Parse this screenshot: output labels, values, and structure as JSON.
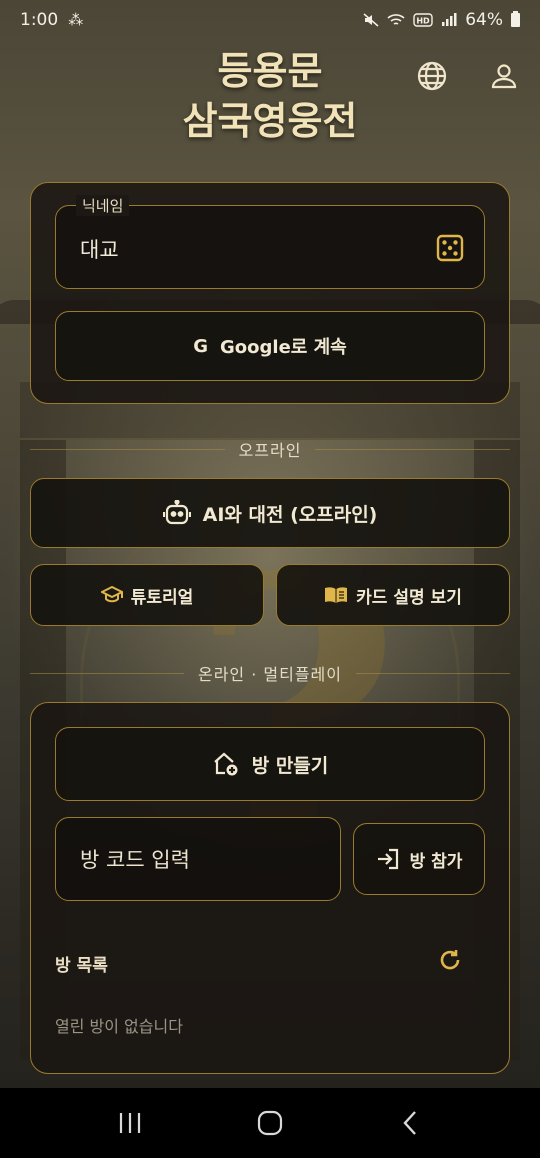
{
  "status_bar": {
    "time": "1:00",
    "notification_icon": "app-notification-icon",
    "battery_percent": "64%",
    "icons": [
      "mute-icon",
      "wifi-icon",
      "hd-icon",
      "signal-icon",
      "battery-icon"
    ]
  },
  "header": {
    "title_line1": "등용문",
    "title_line2": "삼국영웅전",
    "globe_icon": "globe-icon",
    "user_icon": "user-icon"
  },
  "login": {
    "nickname_label": "닉네임",
    "nickname_value": "대교",
    "google_g": "G",
    "google_button": "Google로 계속"
  },
  "offline": {
    "section_label": "오프라인",
    "ai_button": "AI와 대전 (오프라인)",
    "tutorial_button": "튜토리얼",
    "card_guide_button": "카드 설명 보기"
  },
  "online": {
    "section_label": "온라인 · 멀티플레이",
    "create_room_button": "방 만들기",
    "room_code_placeholder": "방 코드 입력",
    "join_button": "방 참가",
    "room_list_title": "방 목록",
    "empty_message": "열린 방이 없습니다"
  },
  "colors": {
    "accent_gold": "#9a7a2c",
    "icon_gold": "#e0b54a",
    "panel_bg": "#1a1612",
    "text_light": "#f2e9d2"
  }
}
